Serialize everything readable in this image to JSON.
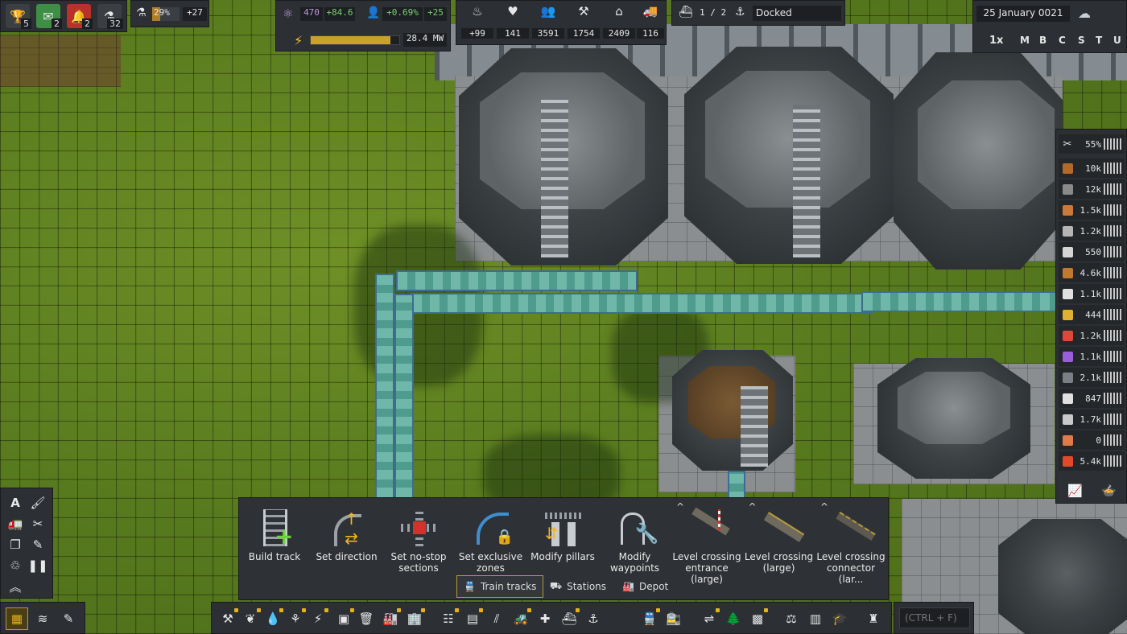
{
  "top_left": {
    "achievements_count": "5",
    "messages_count": "2",
    "alerts_count": "2",
    "research_queue_count": "32",
    "research_progress": "29%",
    "research_rate": "+27"
  },
  "unity": {
    "value": "470",
    "rate": "+84.6",
    "health_pct": "+0.69%",
    "pop_rate": "+25",
    "power": "28.4 MW",
    "power_fraction": 0.9
  },
  "stats": [
    {
      "icon": "food-icon",
      "value": "+99"
    },
    {
      "icon": "health-icon",
      "value": "141"
    },
    {
      "icon": "population-icon",
      "value": "3591"
    },
    {
      "icon": "workers-icon",
      "value": "1754"
    },
    {
      "icon": "housing-icon",
      "value": "2409"
    },
    {
      "icon": "vehicles-icon",
      "value": "116"
    }
  ],
  "ship": {
    "counter": "1 / 2",
    "status": "Docked"
  },
  "date": {
    "text": "25 January 0021",
    "speed": "1x",
    "keys": [
      "M",
      "B",
      "C",
      "S",
      "T",
      "U"
    ]
  },
  "resources": {
    "maintenance": "55%",
    "items": [
      {
        "icon": "wood-icon",
        "value": "10k",
        "color": "#b06a2a"
      },
      {
        "icon": "rock-icon",
        "value": "12k",
        "color": "#8a8a8a"
      },
      {
        "icon": "copper-plate-icon",
        "value": "1.5k",
        "color": "#c97a3a"
      },
      {
        "icon": "iron-plate-icon",
        "value": "1.2k",
        "color": "#b5b5b5"
      },
      {
        "icon": "steel-icon",
        "value": "550",
        "color": "#d5d5d5"
      },
      {
        "icon": "bread-icon",
        "value": "4.6k",
        "color": "#c07a2e"
      },
      {
        "icon": "worker-tier1-icon",
        "value": "1.1k",
        "color": "#e0e0e0"
      },
      {
        "icon": "worker-tier2-icon",
        "value": "444",
        "color": "#e0b030"
      },
      {
        "icon": "worker-tier3-icon",
        "value": "1.2k",
        "color": "#d84a3a"
      },
      {
        "icon": "worker-tier4-icon",
        "value": "1.1k",
        "color": "#9a5ed8"
      },
      {
        "icon": "glass-icon",
        "value": "2.1k",
        "color": "#7a7f86"
      },
      {
        "icon": "wrench-icon",
        "value": "847",
        "color": "#e0e0e0"
      },
      {
        "icon": "concrete-icon",
        "value": "1.7k",
        "color": "#c9c9c9"
      },
      {
        "icon": "medkit-icon",
        "value": "0",
        "color": "#e07a4a"
      },
      {
        "icon": "fuel-icon",
        "value": "5.4k",
        "color": "#e04a2a"
      }
    ]
  },
  "tools": [
    {
      "label": "Build track"
    },
    {
      "label": "Set direction"
    },
    {
      "label": "Set no-stop sections"
    },
    {
      "label": "Set exclusive zones"
    },
    {
      "label": "Modify pillars"
    },
    {
      "label": "Modify waypoints"
    },
    {
      "label": "Level crossing entrance (large)"
    },
    {
      "label": "Level crossing (large)"
    },
    {
      "label": "Level crossing connector (lar..."
    }
  ],
  "tabs": [
    {
      "label": "Train tracks"
    },
    {
      "label": "Stations"
    },
    {
      "label": "Depot"
    }
  ],
  "search": {
    "placeholder": "(CTRL + F)"
  },
  "colors": {
    "accent": "#e3b21a",
    "panel": "#2c2f33",
    "positive": "#78d26f"
  }
}
